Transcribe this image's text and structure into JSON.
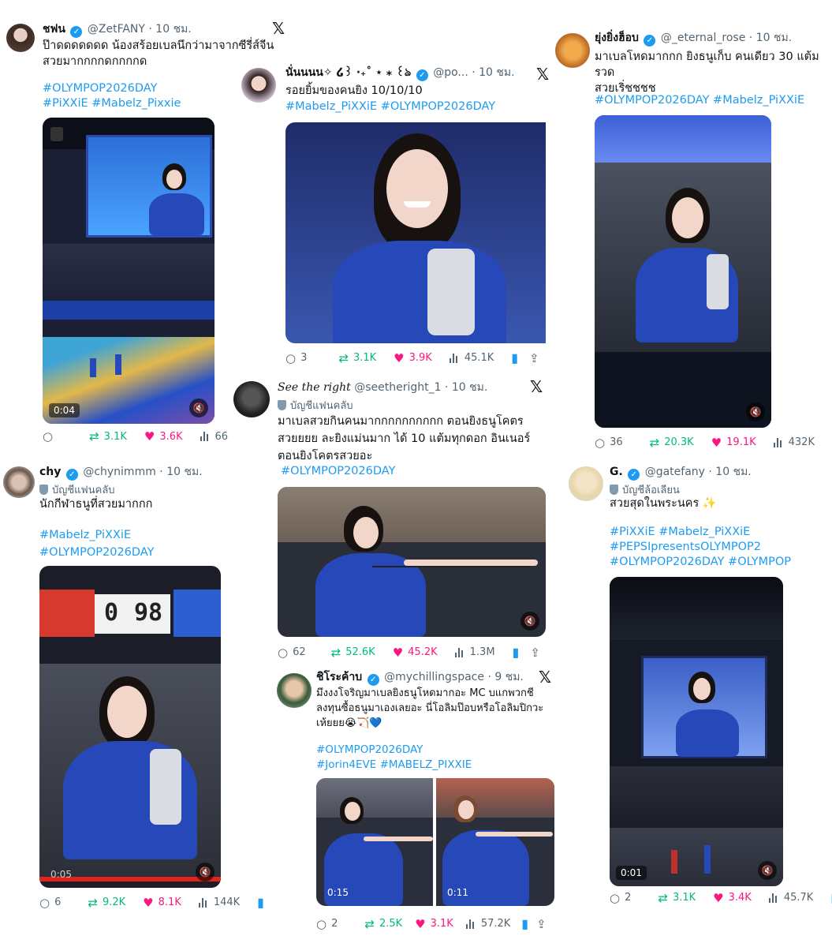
{
  "tweets": [
    {
      "name": "ชฟน",
      "handle": "@ZetFANY",
      "time": "· 10 ชม.",
      "body": "ป๊าดดดดดดด น้องสร้อยเบลนึกว่ามาจากซีรี่ส์จีน สวยมากกกกดกกกกด",
      "tags": "#OLYMPOP2026DAY\n#PiXXiE #Mabelz_Pixxie",
      "timer": "0:04",
      "replies": "",
      "retweets": "3.1K",
      "likes": "3.6K",
      "views": "66"
    },
    {
      "name": "นั่นนนน✧ ໒꒱ ‧₊˚ ⋆ ⁎ ꒰ঌ",
      "handle": "@po...",
      "time": "· 10 ชม.",
      "body": "รอยยิ้มของคนยิง 10/10/10",
      "tags": "#Mabelz_PiXXiE #OLYMPOP2026DAY",
      "replies": "3",
      "retweets": "3.1K",
      "likes": "3.9K",
      "views": "45.1K"
    },
    {
      "name": "ยุ่งยิ่งฮ็อบ",
      "handle": "@_eternal_rose",
      "time": "· 10 ชม.",
      "body": "มาเบลโหดมากกก ยิงธนูเก็บ คนเดียว 30 แต้มรวด\nสวยเริ่ชชชช",
      "tags": "#OLYMPOP2026DAY #Mabelz_PiXXiE",
      "replies": "36",
      "retweets": "20.3K",
      "likes": "19.1K",
      "views": "432K"
    },
    {
      "name": "See the right",
      "handle": "@seetheright_1",
      "time": "· 10 ชม.",
      "sub": "บัญชีแฟนคลับ",
      "body": "มาเบลสวยกินคนมากกกกกกกกกก ตอนยิงธนูโคตร\nสวยยยย ละยิงแม่นมาก ได้ 10 แต้มทุกดอก อินเนอร์\nตอนยิงโคตรสวยอะ",
      "tags": "#OLYMPOP2026DAY",
      "replies": "62",
      "retweets": "52.6K",
      "likes": "45.2K",
      "views": "1.3M"
    },
    {
      "name": "chy",
      "handle": "@chynimmm",
      "time": "· 10 ชม.",
      "sub": "บัญชีแฟนคลับ",
      "body": "นักกีฬาธนูที่สวยมากกก",
      "tags": "#Mabelz_PiXXiE\n#OLYMPOP2026DAY",
      "timer": "0:05",
      "score_left": "0",
      "score_right": "98",
      "replies": "6",
      "retweets": "9.2K",
      "likes": "8.1K",
      "views": "144K"
    },
    {
      "name": "G.",
      "handle": "@gatefany",
      "time": "· 10 ชม.",
      "sub": "บัญชีล้อเลียน",
      "body": "สวยสุดในพระนคร ✨",
      "tags": "#PiXXiE #Mabelz_PiXXiE\n#PEPSIpresentsOLYMPOP2\n#OLYMPOP2026DAY #OLYMPOP",
      "timer": "0:01",
      "replies": "2",
      "retweets": "3.1K",
      "likes": "3.4K",
      "views": "45.7K"
    },
    {
      "name": "ชิโระค้าบ",
      "handle": "@mychillingspace",
      "time": "· 9 ชม.",
      "body": "มึงงงโจริญมาเบลยิงธนูโหดมากอะ MC บแกพวกชี\nลงทุนซื้อธนูมาเองเลยอะ นี่โอลิมป๊อบหรือโอลิมปิกวะ\nเห้ยยย😭🏹💙",
      "tags": "#OLYMPOP2026DAY\n#Jorin4EVE #MABELZ_PIXXIE",
      "timer1": "0:15",
      "timer2": "0:11",
      "replies": "2",
      "retweets": "2.5K",
      "likes": "3.1K",
      "views": "57.2K"
    }
  ],
  "icons": {
    "x_logo": "𝕏",
    "reply": "○",
    "retweet": "⇄",
    "like": "♥",
    "bookmark": "▮",
    "share": "⇪",
    "mute": "🔇",
    "verified": "✓",
    "sparkle": "✨"
  },
  "colors": {
    "link": "#1d9bf0",
    "retweet": "#00ba7c",
    "like": "#f91880",
    "muted": "#536471",
    "jersey": "#2748b8"
  }
}
